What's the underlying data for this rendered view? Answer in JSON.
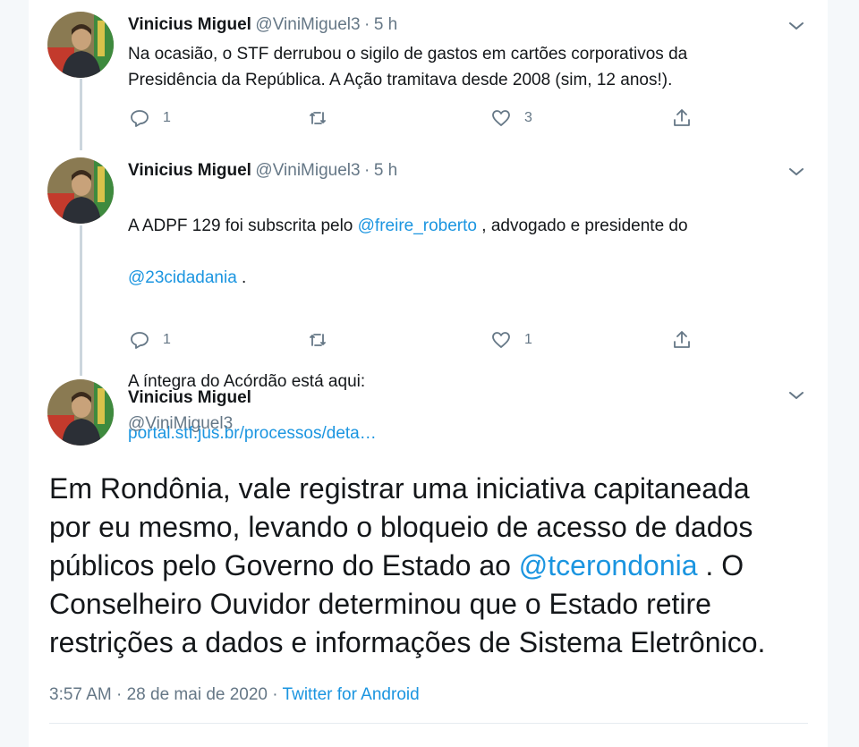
{
  "tweets": [
    {
      "name": "Vinicius Miguel",
      "handle": "@ViniMiguel3",
      "sep": "·",
      "time": "5 h",
      "text": "Na ocasião, o STF derrubou o sigilo de gastos em cartões corporativos da\nPresidência da República. A Ação tramitava desde 2008 (sim, 12 anos!).",
      "reply_count": "1",
      "retweet_count": "",
      "like_count": "3"
    },
    {
      "name": "Vinicius Miguel",
      "handle": "@ViniMiguel3",
      "sep": "·",
      "time": "5 h",
      "text_prefix": "A ADPF 129 foi subscrita pelo ",
      "mention1": "@freire_roberto",
      "text_mid": " , advogado e presidente do",
      "mention2": "@23cidadania",
      "text_suffix": " .",
      "text_line3": "A íntegra do Acórdão está aqui:",
      "link": "portal.stf.jus.br/processos/deta…",
      "reply_count": "1",
      "retweet_count": "",
      "like_count": "1"
    }
  ],
  "main_tweet": {
    "name": "Vinicius Miguel",
    "handle": "@ViniMiguel3",
    "text_line1": "Em Rondônia, vale registrar uma iniciativa capitaneada",
    "text_line2": "por eu mesmo, levando o bloqueio de acesso de dados",
    "text_line3_prefix": "públicos pelo Governo do Estado ao ",
    "mention": "@tcerondonia",
    "text_line3_suffix": " . O",
    "text_line4": "Conselheiro Ouvidor determinou que o Estado retire",
    "text_line5": "restrições a dados e informações de Sistema Eletrônico.",
    "timestamp": "3:57 AM · 28 de mai de 2020 · ",
    "source": "Twitter for Android"
  },
  "colors": {
    "link": "#1b95e0",
    "muted": "#657786",
    "thread_line": "#ccd6dd"
  },
  "icons": [
    "reply-icon",
    "retweet-icon",
    "like-icon",
    "share-icon",
    "chevron-down-icon"
  ]
}
